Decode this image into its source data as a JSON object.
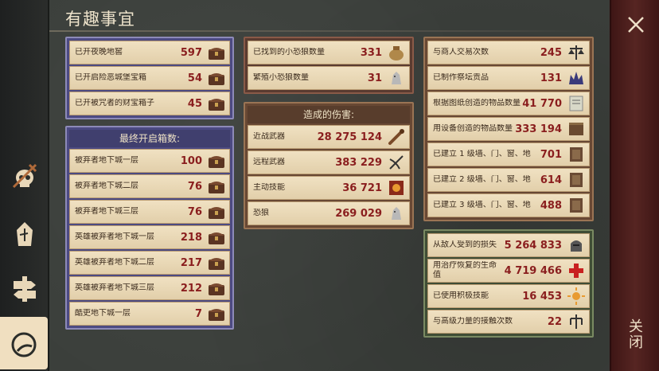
{
  "title": "有趣事宜",
  "close_label": "关闭",
  "colors": {
    "value_red": "#8a1e1e",
    "panel_purple": "#4c4a82",
    "panel_brown": "#5a3b30",
    "panel_green": "#3f4d35"
  },
  "sidebar": {
    "items": [
      {
        "icon": "skull-dagger-icon"
      },
      {
        "icon": "chess-piece-icon"
      },
      {
        "icon": "signpost-icon"
      },
      {
        "icon": "crescent-moon-icon",
        "active": true
      }
    ]
  },
  "left_top": {
    "rows": [
      {
        "label": "已开夜晚地窖",
        "value": "597",
        "icon": "chest-icon"
      },
      {
        "label": "已开启险恶城堡宝箱",
        "value": "54",
        "icon": "chest-icon"
      },
      {
        "label": "已开被咒者的财宝箱子",
        "value": "45",
        "icon": "chest-icon"
      }
    ]
  },
  "left_bottom": {
    "header": "最终开启箱数:",
    "rows": [
      {
        "label": "被弃者地下城一层",
        "value": "100",
        "icon": "chest-icon"
      },
      {
        "label": "被弃者地下城二层",
        "value": "76",
        "icon": "chest-icon"
      },
      {
        "label": "被弃者地下城三层",
        "value": "76",
        "icon": "chest-icon"
      },
      {
        "label": "英雄被弃者地下城一层",
        "value": "218",
        "icon": "chest-icon"
      },
      {
        "label": "英雄被弃者地下城二层",
        "value": "217",
        "icon": "chest-icon"
      },
      {
        "label": "英雄被弃者地下城三层",
        "value": "212",
        "icon": "chest-icon"
      },
      {
        "label": "酷吏地下城一层",
        "value": "7",
        "icon": "chest-icon"
      }
    ]
  },
  "mid_top": {
    "rows": [
      {
        "label": "已找到的小恐狼数量",
        "value": "331",
        "icon": "bag-icon"
      },
      {
        "label": "繁殖小恐狼数量",
        "value": "31",
        "icon": "wolf-icon"
      }
    ]
  },
  "mid_bottom": {
    "header": "造成的伤害:",
    "rows": [
      {
        "label": "近战武器",
        "value": "28 275 124",
        "icon": "club-icon"
      },
      {
        "label": "远程武器",
        "value": "383 229",
        "icon": "crossbow-icon"
      },
      {
        "label": "主动技能",
        "value": "36 721",
        "icon": "skill-book-icon"
      },
      {
        "label": "恐狼",
        "value": "269 029",
        "icon": "wolf-icon"
      }
    ]
  },
  "right_top": {
    "rows": [
      {
        "label": "与商人交易次数",
        "value": "245",
        "icon": "scales-icon"
      },
      {
        "label": "已制作祭坛贡品",
        "value": "131",
        "icon": "crown-icon"
      },
      {
        "label": "根据图纸创造的物品数量",
        "value": "41 770",
        "icon": "blueprint-icon"
      },
      {
        "label": "用设备创造的物品数量",
        "value": "333 194",
        "icon": "workbench-icon"
      },
      {
        "label": "已建立 1 级墙、门、窗、地",
        "value": "701",
        "icon": "wall-icon"
      },
      {
        "label": "已建立 2 级墙、门、窗、地",
        "value": "614",
        "icon": "wall-icon"
      },
      {
        "label": "已建立 3 级墙、门、窗、地",
        "value": "488",
        "icon": "wall-icon"
      }
    ]
  },
  "right_bottom": {
    "rows": [
      {
        "label": "从敌人受到的损失",
        "value": "5 264 833",
        "icon": "helmet-icon"
      },
      {
        "label": "用治疗恢复的生命值",
        "value": "4 719 466",
        "icon": "red-cross-icon"
      },
      {
        "label": "已使用积极技能",
        "value": "16 453",
        "icon": "sun-icon"
      },
      {
        "label": "与高级力量的接触次数",
        "value": "22",
        "icon": "rune-icon"
      }
    ]
  }
}
